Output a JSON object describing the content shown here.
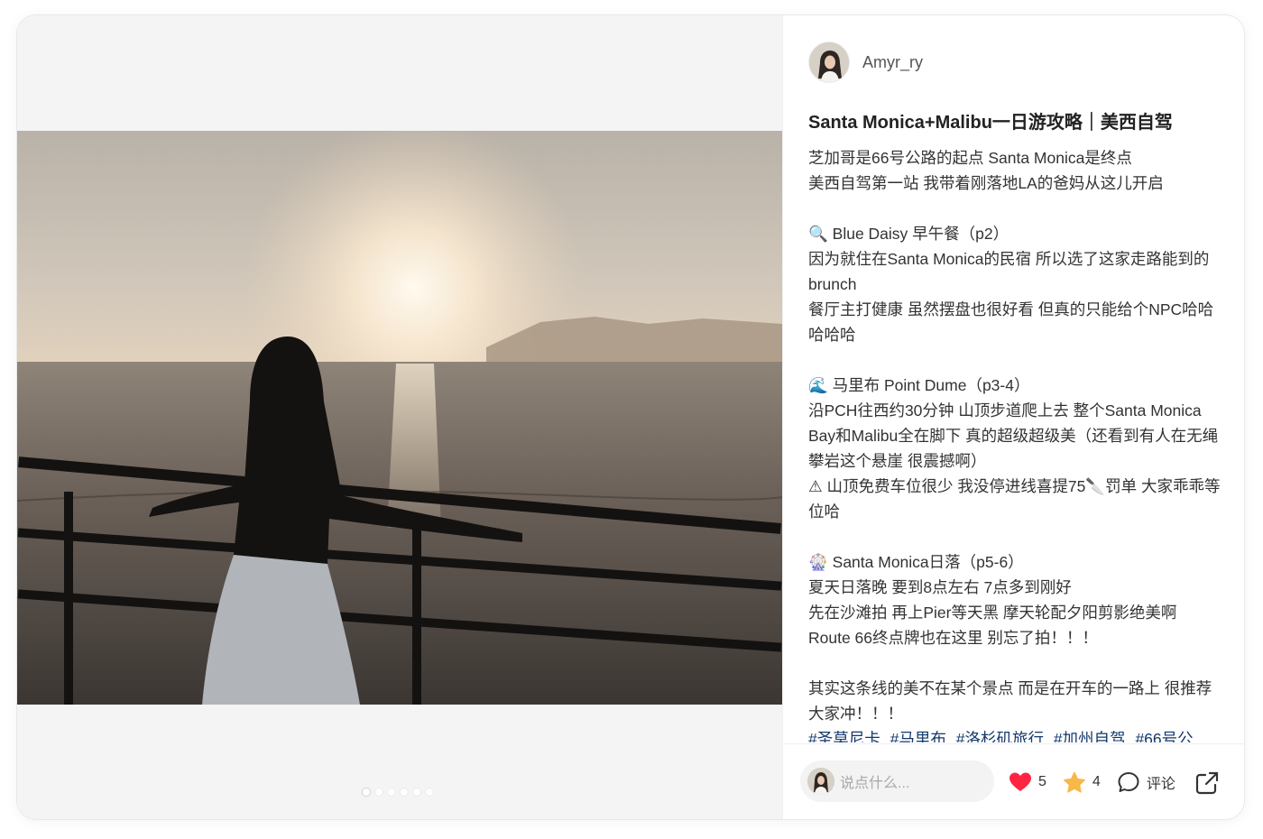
{
  "author": {
    "name": "Amyr_ry"
  },
  "post": {
    "title": "Santa Monica+Malibu一日游攻略｜美西自驾",
    "paragraphs": [
      "芝加哥是66号公路的起点 Santa Monica是终点",
      "美西自驾第一站 我带着刚落地LA的爸妈从这儿开启",
      "",
      "🔍 Blue Daisy 早午餐（p2）",
      "因为就住在Santa Monica的民宿 所以选了这家走路能到的brunch",
      "餐厅主打健康 虽然摆盘也很好看 但真的只能给个NPC哈哈哈哈哈",
      "",
      "🌊 马里布 Point Dume（p3-4）",
      "沿PCH往西约30分钟 山顶步道爬上去 整个Santa Monica Bay和Malibu全在脚下 真的超级超级美（还看到有人在无绳攀岩这个悬崖 很震撼啊）",
      "⚠ 山顶免费车位很少 我没停进线喜提75🔪罚单 大家乖乖等位哈",
      "",
      "🎡 Santa Monica日落（p5-6）",
      "夏天日落晚 要到8点左右 7点多到刚好",
      "先在沙滩拍 再上Pier等天黑 摩天轮配夕阳剪影绝美啊",
      "Route 66终点牌也在这里 别忘了拍！！！",
      "",
      "其实这条线的美不在某个景点 而是在开车的一路上 很推荐大家冲！！！"
    ],
    "tags": [
      "#圣莫尼卡",
      "#马里布",
      "#洛杉矶旅行",
      "#加州自驾",
      "#66号公"
    ]
  },
  "footer": {
    "comment_placeholder": "说点什么...",
    "likes": "5",
    "favorites": "4",
    "comment_label": "评论"
  },
  "carousel": {
    "count": 6,
    "active": 0
  },
  "colors": {
    "like": "#ff2442",
    "star": "#f7b84a",
    "tag": "#13386c"
  },
  "icons": [
    "heart-icon",
    "star-icon",
    "comment-icon",
    "share-icon"
  ]
}
